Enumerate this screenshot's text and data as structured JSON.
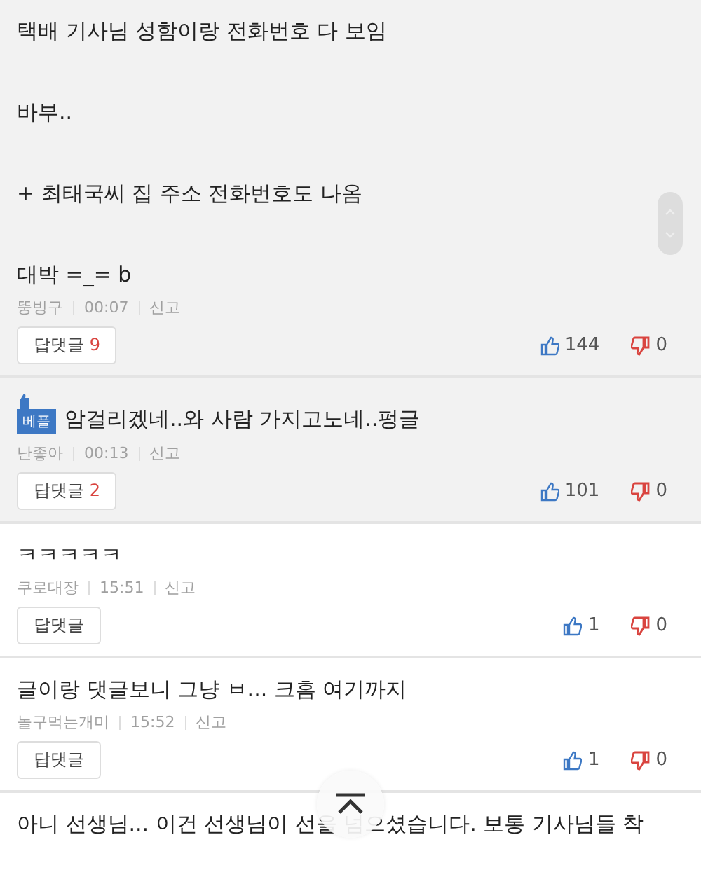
{
  "comments": [
    {
      "highlighted": true,
      "paragraphs": [
        "택배 기사님 성함이랑 전화번호 다 보임",
        "바부..",
        "+ 최태국씨 집 주소 전화번호도 나옴",
        "대박 =_= b"
      ],
      "author": "뚱빙구",
      "time": "00:07",
      "report": "신고",
      "reply_label": "답댓글",
      "reply_count": "9",
      "likes": "144",
      "dislikes": "0"
    },
    {
      "highlighted": true,
      "badge": "베플",
      "paragraphs": [
        "암걸리겠네..와 사람 가지고노네..펑글"
      ],
      "author": "난좋아",
      "time": "00:13",
      "report": "신고",
      "reply_label": "답댓글",
      "reply_count": "2",
      "likes": "101",
      "dislikes": "0"
    },
    {
      "highlighted": false,
      "paragraphs": [
        "ㅋㅋㅋㅋㅋ"
      ],
      "author": "쿠로대장",
      "time": "15:51",
      "report": "신고",
      "reply_label": "답댓글",
      "likes": "1",
      "dislikes": "0"
    },
    {
      "highlighted": false,
      "paragraphs": [
        "글이랑 댓글보니 그냥 ㅂ... 크흠 여기까지"
      ],
      "author": "놀구먹는개미",
      "time": "15:52",
      "report": "신고",
      "reply_label": "답댓글",
      "likes": "1",
      "dislikes": "0"
    },
    {
      "highlighted": false,
      "paragraphs": [
        "아니 선생님... 이건 선생님이 선을 넘으셨습니다. 보통 기사님들 착"
      ]
    }
  ]
}
